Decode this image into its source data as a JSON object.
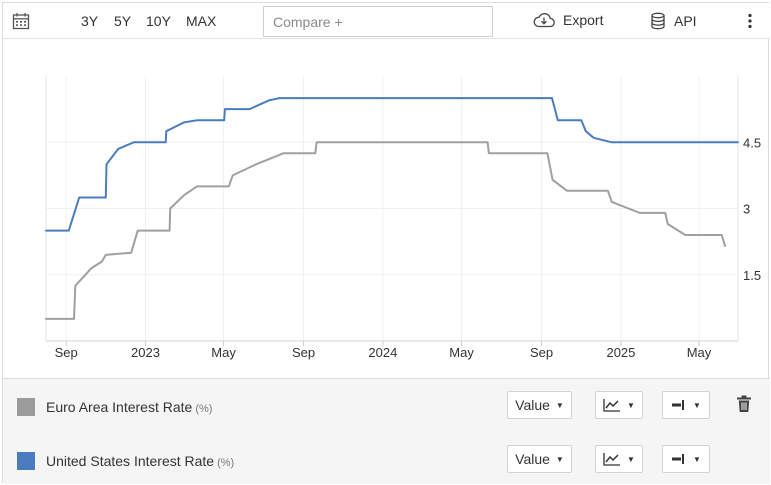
{
  "toolbar": {
    "ranges": [
      "3Y",
      "5Y",
      "10Y",
      "MAX"
    ],
    "compare_placeholder": "Compare +",
    "export_label": "Export",
    "api_label": "API",
    "icons": {
      "calendar": "calendar-icon",
      "export": "cloud-download-icon",
      "api": "database-icon",
      "menu": "kebab-menu-icon"
    }
  },
  "chart_data": {
    "type": "line",
    "title": "",
    "xlabel": "",
    "ylabel": "",
    "x_tick_labels": [
      "Sep",
      "2023",
      "May",
      "Sep",
      "2024",
      "May",
      "Sep",
      "2025",
      "May"
    ],
    "x_tick_dates": [
      "2022-09-01",
      "2023-01-01",
      "2023-05-01",
      "2023-09-01",
      "2024-01-01",
      "2024-05-01",
      "2024-09-01",
      "2025-01-01",
      "2025-05-01"
    ],
    "y_ticks": [
      1.5,
      3,
      4.5
    ],
    "ylim": [
      0,
      6.0
    ],
    "xlim": [
      "2022-08-01",
      "2025-06-30"
    ],
    "grid": true,
    "y_axis_side": "right",
    "series": [
      {
        "name": "Euro Area Interest Rate",
        "color": "#a0a0a0",
        "points": [
          [
            "2022-08-01",
            0.5
          ],
          [
            "2022-09-13",
            0.5
          ],
          [
            "2022-09-15",
            1.25
          ],
          [
            "2022-10-10",
            1.65
          ],
          [
            "2022-10-26",
            1.8
          ],
          [
            "2022-11-01",
            1.95
          ],
          [
            "2022-12-10",
            2.0
          ],
          [
            "2022-12-20",
            2.5
          ],
          [
            "2023-02-07",
            2.5
          ],
          [
            "2023-02-08",
            3.0
          ],
          [
            "2023-03-01",
            3.3
          ],
          [
            "2023-03-21",
            3.5
          ],
          [
            "2023-05-09",
            3.5
          ],
          [
            "2023-05-15",
            3.75
          ],
          [
            "2023-06-20",
            4.0
          ],
          [
            "2023-08-01",
            4.25
          ],
          [
            "2023-09-19",
            4.25
          ],
          [
            "2023-09-21",
            4.5
          ],
          [
            "2024-06-10",
            4.5
          ],
          [
            "2024-06-12",
            4.25
          ],
          [
            "2024-09-10",
            4.25
          ],
          [
            "2024-09-18",
            3.65
          ],
          [
            "2024-10-10",
            3.4
          ],
          [
            "2024-12-12",
            3.4
          ],
          [
            "2024-12-18",
            3.15
          ],
          [
            "2025-01-30",
            2.9
          ],
          [
            "2025-03-10",
            2.9
          ],
          [
            "2025-03-14",
            2.65
          ],
          [
            "2025-04-10",
            2.4
          ],
          [
            "2025-06-05",
            2.4
          ],
          [
            "2025-06-10",
            2.15
          ]
        ]
      },
      {
        "name": "United States Interest Rate",
        "color": "#4a7cbf",
        "points": [
          [
            "2022-08-01",
            2.5
          ],
          [
            "2022-09-05",
            2.5
          ],
          [
            "2022-09-21",
            3.25
          ],
          [
            "2022-11-01",
            3.25
          ],
          [
            "2022-11-02",
            4.0
          ],
          [
            "2022-11-20",
            4.35
          ],
          [
            "2022-12-14",
            4.5
          ],
          [
            "2023-02-01",
            4.5
          ],
          [
            "2023-02-02",
            4.75
          ],
          [
            "2023-03-01",
            4.95
          ],
          [
            "2023-03-22",
            5.0
          ],
          [
            "2023-05-02",
            5.0
          ],
          [
            "2023-05-03",
            5.25
          ],
          [
            "2023-06-10",
            5.25
          ],
          [
            "2023-07-10",
            5.45
          ],
          [
            "2023-07-26",
            5.5
          ],
          [
            "2024-09-17",
            5.5
          ],
          [
            "2024-09-26",
            5.0
          ],
          [
            "2024-11-01",
            5.0
          ],
          [
            "2024-11-08",
            4.75
          ],
          [
            "2024-11-20",
            4.6
          ],
          [
            "2024-12-18",
            4.5
          ],
          [
            "2025-06-30",
            4.5
          ]
        ]
      }
    ]
  },
  "legend": {
    "series": [
      {
        "name": "Euro Area Interest Rate",
        "unit": "(%)",
        "color": "#9b9b9b",
        "mode": "Value"
      },
      {
        "name": "United States Interest Rate",
        "unit": "(%)",
        "color": "#4a7cbf",
        "mode": "Value"
      }
    ],
    "icons": {
      "chart_type": "line-chart-icon",
      "style": "line-style-icon",
      "caret": "caret-down-icon",
      "delete": "trash-icon"
    }
  }
}
